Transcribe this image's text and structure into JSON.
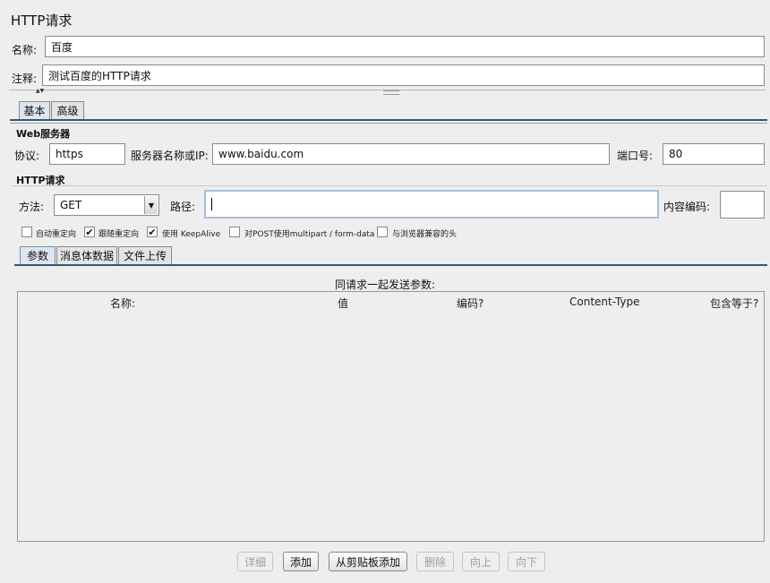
{
  "panel": {
    "title": "HTTP请求"
  },
  "name_row": {
    "label": "名称:",
    "value": "百度"
  },
  "comment_row": {
    "label": "注释:",
    "value": "测试百度的HTTP请求"
  },
  "divider": {
    "arrows": "▲▼"
  },
  "tabs": [
    {
      "label": "基本"
    },
    {
      "label": "高级"
    }
  ],
  "web_server": {
    "title": "Web服务器",
    "protocol_label": "协议:",
    "protocol_value": "https",
    "server_label": "服务器名称或IP:",
    "server_value": "www.baidu.com",
    "port_label": "端口号:",
    "port_value": "80"
  },
  "http_request": {
    "title": "HTTP请求",
    "method_label": "方法:",
    "method_value": "GET",
    "path_label": "路径:",
    "path_value": "",
    "encoding_label": "内容编码:",
    "encoding_value": ""
  },
  "options": [
    {
      "label": "自动重定向",
      "checked": false
    },
    {
      "label": "跟随重定向",
      "checked": true
    },
    {
      "label": "使用 KeepAlive",
      "checked": true
    },
    {
      "label": "对POST使用multipart / form-data",
      "checked": false
    },
    {
      "label": "与浏览器兼容的头",
      "checked": false
    }
  ],
  "sub_tabs": [
    {
      "label": "参数"
    },
    {
      "label": "消息体数据"
    },
    {
      "label": "文件上传"
    }
  ],
  "params": {
    "caption": "同请求一起发送参数:",
    "columns": [
      "名称:",
      "值",
      "编码?",
      "Content-Type",
      "包含等于?"
    ]
  },
  "buttons": {
    "detail": "详细",
    "add": "添加",
    "add_clipboard": "从剪贴板添加",
    "delete": "删除",
    "up": "向上",
    "down": "向下"
  },
  "colors": {
    "background": "#eeeeee",
    "selected_tab": "#dde6f0",
    "separator": "#3d5570"
  }
}
